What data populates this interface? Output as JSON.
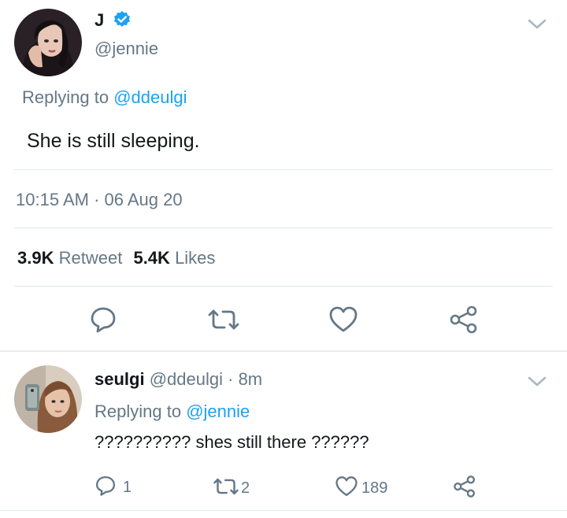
{
  "main_tweet": {
    "author_name": "J",
    "handle": "@jennie",
    "replying_prefix": "Replying to",
    "replying_to": "@ddeulgi",
    "text": "She is still sleeping.",
    "timestamp": "10:15 AM · 06 Aug 20",
    "retweet_count": "3.9K",
    "retweet_label": "Retweet",
    "like_count": "5.4K",
    "like_label": "Likes",
    "actions": [
      "reply-icon",
      "retweet-icon",
      "like-icon",
      "share-icon"
    ]
  },
  "reply_tweet": {
    "author_name": "seulgi",
    "handle": "@ddeulgi",
    "time_ago": "· 8m",
    "replying_prefix": "Replying to",
    "replying_to": "@jennie",
    "text": "?????????? shes still there ??????",
    "reply_count": "1",
    "retweet_count": "2",
    "like_count": "189"
  },
  "colors": {
    "link": "#1da1f2",
    "verified": "#1da1f2",
    "muted": "#657786",
    "divider": "#e1e8ed"
  }
}
